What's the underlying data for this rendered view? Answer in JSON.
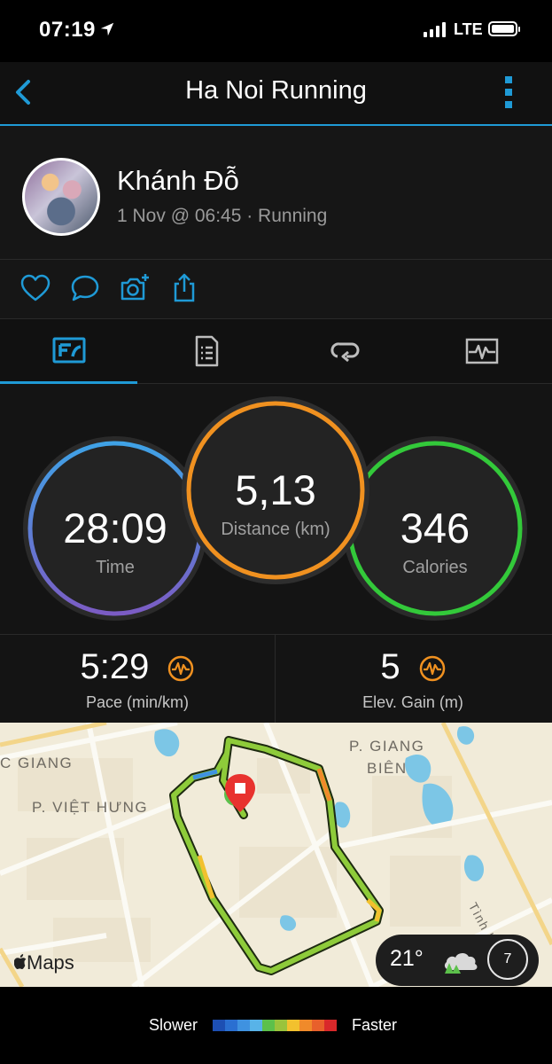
{
  "status_bar": {
    "time": "07:19",
    "network": "LTE"
  },
  "header": {
    "title": "Ha Noi Running"
  },
  "activity": {
    "user_name": "Khánh Đỗ",
    "meta": "1 Nov @ 06:45 · Running"
  },
  "stats": {
    "time": {
      "value": "28:09",
      "label": "Time"
    },
    "distance": {
      "value": "5,13",
      "label": "Distance (km)"
    },
    "calories": {
      "value": "346",
      "label": "Calories"
    },
    "pace": {
      "value": "5:29",
      "label": "Pace (min/km)"
    },
    "elevation": {
      "value": "5",
      "label": "Elev. Gain (m)"
    }
  },
  "map": {
    "labels": [
      "C GIANG",
      "P. VIỆT HƯNG",
      "P. GIANG",
      "BIÊN",
      "Tình lộ"
    ],
    "attribution": "Maps",
    "weather": {
      "temperature": "21°",
      "aqi": "7"
    }
  },
  "legend": {
    "slower": "Slower",
    "faster": "Faster",
    "colors": [
      "#1d4fb3",
      "#2a6fd1",
      "#3f92e0",
      "#58b3e8",
      "#5cc04b",
      "#9ac33c",
      "#f2c12e",
      "#f08a2a",
      "#e8602b",
      "#d9282a"
    ]
  },
  "colors": {
    "accent": "#1f9ad6",
    "time_ring_start": "#3fa2e6",
    "time_ring_end": "#7b5cc4",
    "distance_ring": "#f09120",
    "calories_ring": "#33c93a",
    "route": "#8ecb3a"
  }
}
